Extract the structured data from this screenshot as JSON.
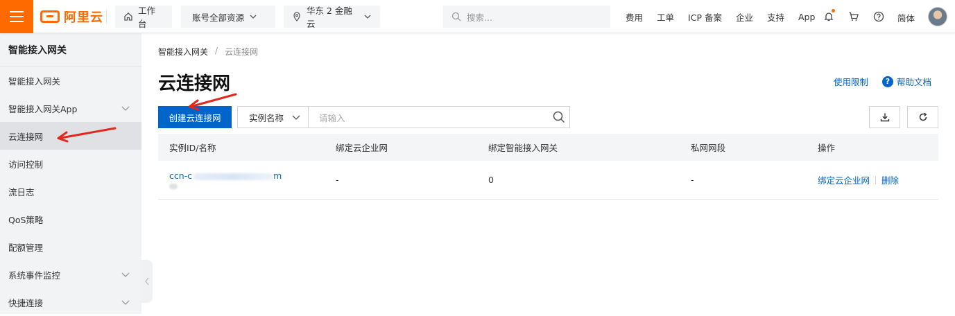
{
  "topbar": {
    "logo_text": "阿里云",
    "workbench": "工作台",
    "account_resources": "账号全部资源",
    "region": "华东 2 金融云",
    "search_placeholder": "搜索...",
    "links": [
      "费用",
      "工单",
      "ICP 备案",
      "企业",
      "支持",
      "App"
    ],
    "language": "简体"
  },
  "sidebar": {
    "title": "智能接入网关",
    "items": [
      {
        "label": "智能接入网关",
        "expandable": false,
        "active": false
      },
      {
        "label": "智能接入网关App",
        "expandable": true,
        "active": false
      },
      {
        "label": "云连接网",
        "expandable": false,
        "active": true
      },
      {
        "label": "访问控制",
        "expandable": false,
        "active": false
      },
      {
        "label": "流日志",
        "expandable": false,
        "active": false
      },
      {
        "label": "QoS策略",
        "expandable": false,
        "active": false
      },
      {
        "label": "配额管理",
        "expandable": false,
        "active": false
      },
      {
        "label": "系统事件监控",
        "expandable": true,
        "active": false
      },
      {
        "label": "快捷连接",
        "expandable": true,
        "active": false
      }
    ]
  },
  "main": {
    "breadcrumb": [
      "智能接入网关",
      "云连接网"
    ],
    "title": "云连接网",
    "usage_limits": "使用限制",
    "help_docs": "帮助文档",
    "create_button": "创建云连接网",
    "filter_select": "实例名称",
    "search_placeholder": "请输入",
    "table": {
      "headers": [
        "实例ID/名称",
        "绑定云企业网",
        "绑定智能接入网关",
        "私网网段",
        "操作"
      ],
      "rows": [
        {
          "id_prefix": "ccn-c",
          "id_suffix": "m",
          "cen": "-",
          "gateways": "0",
          "cidr": "-",
          "actions": [
            "绑定云企业网",
            "删除"
          ]
        }
      ]
    }
  },
  "colors": {
    "brand_orange": "#ff6a00",
    "primary_blue": "#0064c8",
    "annotation_red": "#e0281e"
  },
  "icons": [
    "menu-icon",
    "home-icon",
    "chevron-down-icon",
    "location-icon",
    "search-icon",
    "bell-icon",
    "cart-icon",
    "help-icon",
    "download-icon",
    "refresh-icon"
  ]
}
